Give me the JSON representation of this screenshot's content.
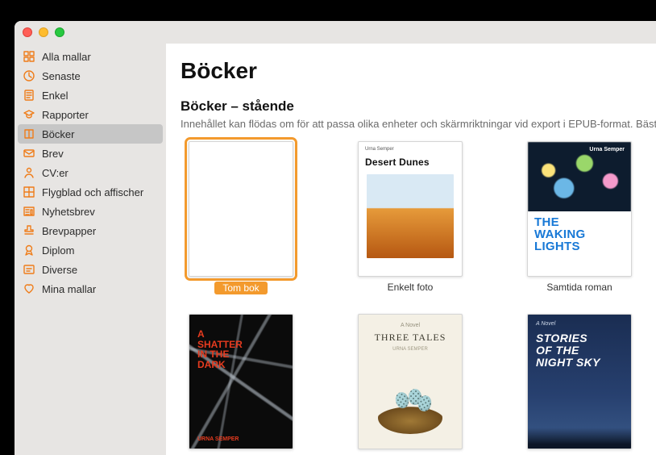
{
  "accent": "#ef7d1a",
  "sidebar": {
    "items": [
      {
        "label": "Alla mallar",
        "icon": "grid-icon",
        "selected": false
      },
      {
        "label": "Senaste",
        "icon": "clock-icon",
        "selected": false
      },
      {
        "label": "Enkel",
        "icon": "page-icon",
        "selected": false
      },
      {
        "label": "Rapporter",
        "icon": "cap-icon",
        "selected": false
      },
      {
        "label": "Böcker",
        "icon": "book-icon",
        "selected": true
      },
      {
        "label": "Brev",
        "icon": "envelope-icon",
        "selected": false
      },
      {
        "label": "CV:er",
        "icon": "person-icon",
        "selected": false
      },
      {
        "label": "Flygblad och affischer",
        "icon": "columns-icon",
        "selected": false
      },
      {
        "label": "Nyhetsbrev",
        "icon": "news-icon",
        "selected": false
      },
      {
        "label": "Brevpapper",
        "icon": "stamp-icon",
        "selected": false
      },
      {
        "label": "Diplom",
        "icon": "ribbon-icon",
        "selected": false
      },
      {
        "label": "Diverse",
        "icon": "misc-icon",
        "selected": false
      },
      {
        "label": "Mina mallar",
        "icon": "heart-icon",
        "selected": false
      }
    ]
  },
  "main": {
    "title": "Böcker",
    "section_title": "Böcker – stående",
    "section_desc": "Innehållet kan flödas om för att passa olika enheter och skärmriktningar vid export i EPUB-format. Bäst fö",
    "templates": [
      {
        "label": "Tom bok",
        "kind": "blank",
        "selected": true
      },
      {
        "label": "Enkelt foto",
        "kind": "desert",
        "selected": false,
        "cover": {
          "author": "Urna Semper",
          "title": "Desert Dunes"
        }
      },
      {
        "label": "Samtida roman",
        "kind": "waking",
        "selected": false,
        "cover": {
          "author": "Urna Semper",
          "title_l1": "THE",
          "title_l2": "WAKING",
          "title_l3": "LIGHTS"
        }
      },
      {
        "label": "",
        "kind": "shatter",
        "selected": false,
        "cover": {
          "author": "URNA SEMPER",
          "title_l1": "A",
          "title_l2": "SHATTER",
          "title_l3": "IN THE",
          "title_l4": "DARK"
        }
      },
      {
        "label": "",
        "kind": "tales",
        "selected": false,
        "cover": {
          "top": "A Novel",
          "title": "THREE TALES",
          "author": "URNA SEMPER"
        }
      },
      {
        "label": "",
        "kind": "night",
        "selected": false,
        "cover": {
          "top": "A Novel",
          "title_l1": "STORIES",
          "title_l2": "OF THE",
          "title_l3": "NIGHT SKY"
        }
      }
    ]
  }
}
